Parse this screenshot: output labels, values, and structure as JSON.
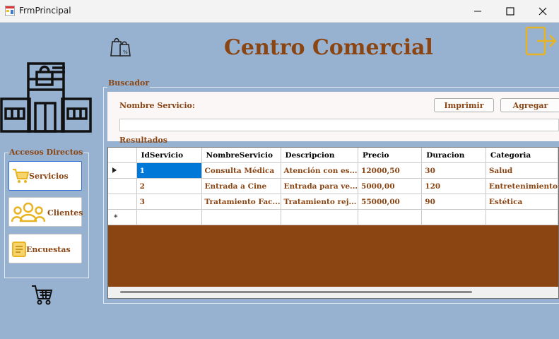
{
  "window": {
    "title": "FrmPrincipal"
  },
  "header": {
    "title": "Centro Comercial"
  },
  "sidebar": {
    "group_label": "Accesos Directos",
    "items": [
      {
        "label": "Servicios",
        "icon": "cart-icon",
        "active": true
      },
      {
        "label": "Clientes",
        "icon": "users-icon",
        "active": false
      },
      {
        "label": "Encuestas",
        "icon": "survey-icon",
        "active": false
      }
    ]
  },
  "search": {
    "group_label": "Buscador",
    "field_label": "Nombre Servicio:",
    "value": "",
    "print_label": "Imprimir",
    "add_label": "Agregar"
  },
  "results": {
    "label": "Resultados",
    "columns": [
      "IdServicio",
      "NombreServicio",
      "Descripcion",
      "Precio",
      "Duracion",
      "Categoria"
    ],
    "rows": [
      [
        "1",
        "Consulta Médica",
        "Atención con es...",
        "12000,50",
        "30",
        "Salud"
      ],
      [
        "2",
        "Entrada a Cine",
        "Entrada para ve...",
        "5000,00",
        "120",
        "Entretenimiento"
      ],
      [
        "3",
        "Tratamiento Fac...",
        "Tratamiento rej...",
        "55000,00",
        "90",
        "Estética"
      ]
    ],
    "new_row_marker": "*"
  },
  "colors": {
    "accent": "#8b4513",
    "background": "#97b2d0",
    "icon_gold": "#e8b423",
    "selection": "#0078d7"
  }
}
